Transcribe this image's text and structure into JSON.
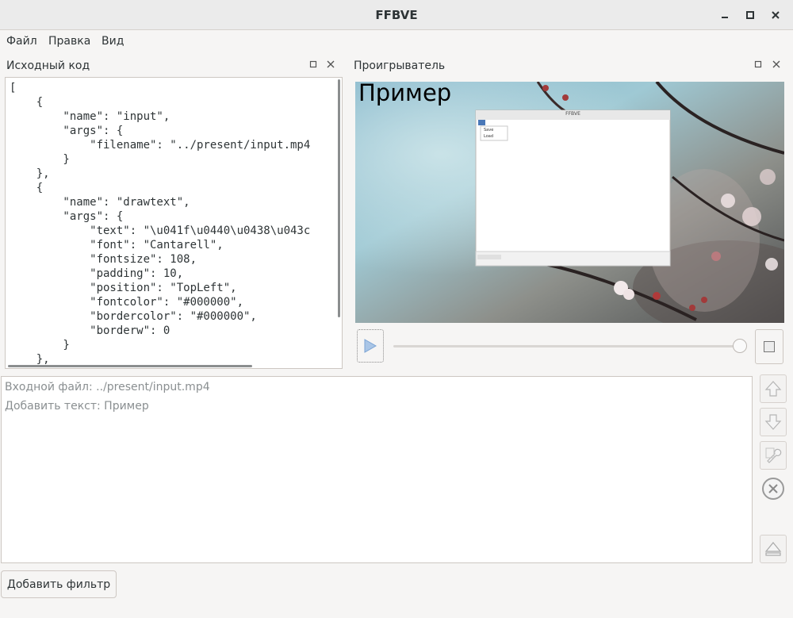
{
  "window": {
    "title": "FFBVE"
  },
  "menu": {
    "items": [
      "Файл",
      "Правка",
      "Вид"
    ]
  },
  "source_panel": {
    "title": "Исходный код",
    "code": "[\n    {\n        \"name\": \"input\",\n        \"args\": {\n            \"filename\": \"../present/input.mp4\n        }\n    },\n    {\n        \"name\": \"drawtext\",\n        \"args\": {\n            \"text\": \"\\u041f\\u0440\\u0438\\u043c\n            \"font\": \"Cantarell\",\n            \"fontsize\": 108,\n            \"padding\": 10,\n            \"position\": \"TopLeft\",\n            \"fontcolor\": \"#000000\",\n            \"bordercolor\": \"#000000\",\n            \"borderw\": 0\n        }\n    },"
  },
  "player_panel": {
    "title": "Проигрыватель",
    "overlay_text": "Пример",
    "inner_window_title": "FFBVE",
    "inner_menu": [
      "Save",
      "Load"
    ],
    "progress": 0.98
  },
  "filters": {
    "items": [
      "Входной файл: ../present/input.mp4",
      "Добавить текст: Пример"
    ]
  },
  "buttons": {
    "add_filter": "Добавить фильтр"
  },
  "colors": {
    "accent": "#4a90d9",
    "window_bg": "#f6f5f4"
  }
}
